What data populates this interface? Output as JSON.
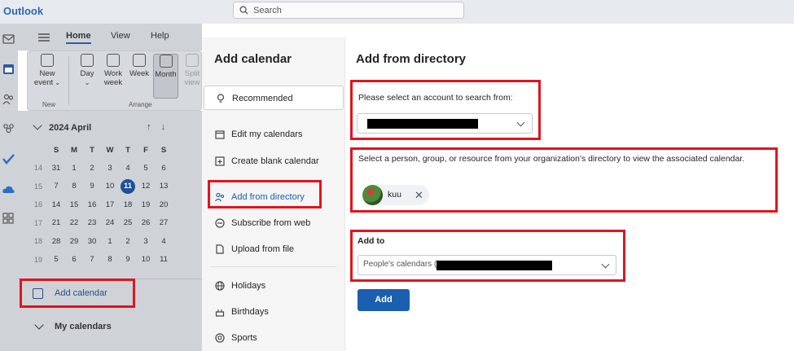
{
  "app": {
    "brand": "Outlook"
  },
  "search": {
    "placeholder": "Search"
  },
  "ribbon": {
    "tabs": [
      "Home",
      "View",
      "Help"
    ],
    "buttons": [
      "New event",
      "Day",
      "Work week",
      "Week",
      "Month",
      "Split view"
    ],
    "new_event_line1": "New",
    "new_event_line2": "event",
    "work_week_line1": "Work",
    "work_week_line2": "week",
    "split_line1": "Split",
    "split_line2": "view",
    "groups": [
      "New",
      "Arrange"
    ]
  },
  "mini_calendar": {
    "title": "2024 April",
    "weekdays": [
      "S",
      "M",
      "T",
      "W",
      "T",
      "F",
      "S"
    ],
    "weeks": [
      {
        "week": "14",
        "days": [
          "31",
          "1",
          "2",
          "3",
          "4",
          "5",
          "6"
        ]
      },
      {
        "week": "15",
        "days": [
          "7",
          "8",
          "9",
          "10",
          "11",
          "12",
          "13"
        ]
      },
      {
        "week": "16",
        "days": [
          "14",
          "15",
          "16",
          "17",
          "18",
          "19",
          "20"
        ]
      },
      {
        "week": "17",
        "days": [
          "21",
          "22",
          "23",
          "24",
          "25",
          "26",
          "27"
        ]
      },
      {
        "week": "18",
        "days": [
          "28",
          "29",
          "30",
          "1",
          "2",
          "3",
          "4"
        ]
      },
      {
        "week": "19",
        "days": [
          "5",
          "6",
          "7",
          "8",
          "9",
          "10",
          "11"
        ]
      }
    ],
    "today": "11"
  },
  "left_pane": {
    "add_calendar": "Add calendar",
    "my_calendars": "My calendars"
  },
  "dialog": {
    "title": "Add calendar",
    "nav": {
      "recommended": "Recommended",
      "edit": "Edit my calendars",
      "create_blank": "Create blank calendar",
      "from_directory": "Add from directory",
      "subscribe": "Subscribe from web",
      "upload": "Upload from file",
      "holidays": "Holidays",
      "birthdays": "Birthdays",
      "sports": "Sports"
    },
    "content": {
      "title": "Add from directory",
      "account_label": "Please select an account to search from:",
      "directory_label": "Select a person, group, or resource from your organization's directory to view the associated calendar.",
      "chip_name": "kuu",
      "add_to_label": "Add to",
      "add_to_value": "People's calendars (",
      "add_button": "Add"
    }
  },
  "colors": {
    "brand": "#2a6ab8",
    "accent": "#1b5fb0",
    "highlight": "#e0141e"
  }
}
